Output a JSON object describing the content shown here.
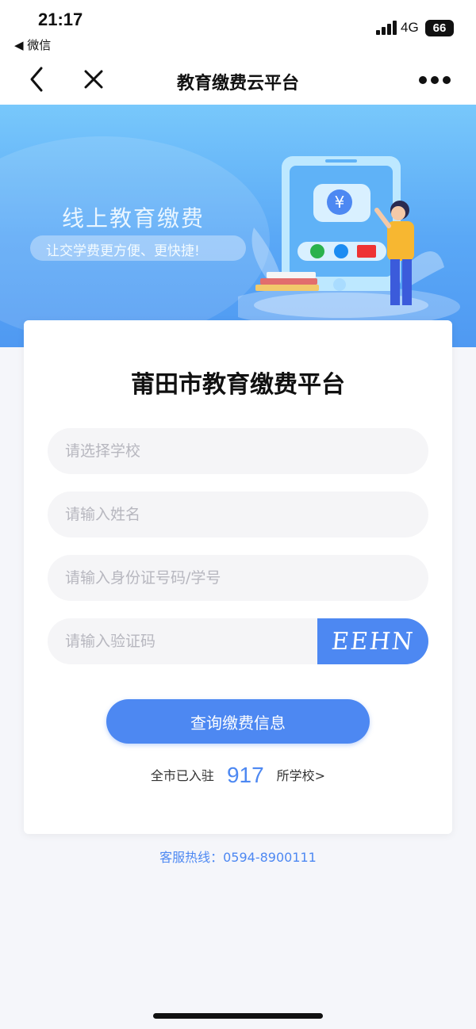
{
  "status_bar": {
    "time": "21:17",
    "back_app": "◀ 微信",
    "network": "4G",
    "battery": "66"
  },
  "nav": {
    "title": "教育缴费云平台"
  },
  "banner": {
    "headline": "线上教育缴费",
    "subtitle": "让交学费更方便、更快捷!",
    "currency_symbol": "¥",
    "colors": {
      "gradient_top": "#78c8fb",
      "gradient_bottom": "#4f99f2"
    }
  },
  "form": {
    "title": "莆田市教育缴费平台",
    "school_placeholder": "请选择学校",
    "name_placeholder": "请输入姓名",
    "id_placeholder": "请输入身份证号码/学号",
    "captcha_placeholder": "请输入验证码",
    "captcha_text": "EEHN",
    "submit_label": "查询缴费信息",
    "stats_prefix": "全市已入驻",
    "school_count": "917",
    "stats_suffix": "所学校>"
  },
  "hotline": "客服热线：0594-8900111",
  "colors": {
    "accent": "#4d88f2"
  }
}
